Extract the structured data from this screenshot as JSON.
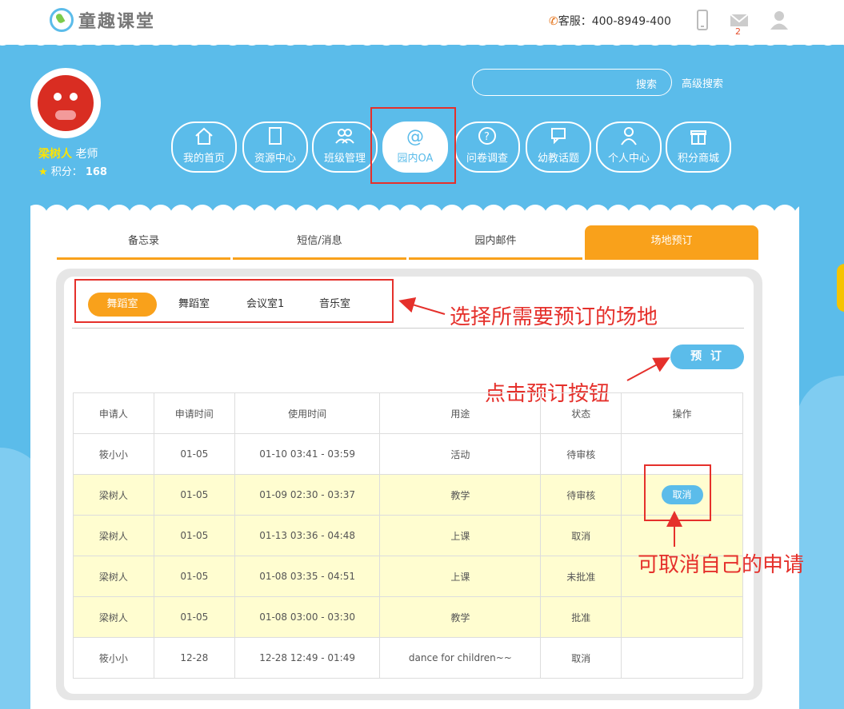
{
  "header": {
    "logo_text": "童趣课堂",
    "service_label": "客服：400-8949-400",
    "mail_badge": "2"
  },
  "profile": {
    "name": "梁树人",
    "role": "老师",
    "points_label": "积分：",
    "points_value": "168"
  },
  "search": {
    "button": "搜索",
    "advanced": "高级搜索"
  },
  "nav": [
    {
      "label": "我的首页",
      "icon": "home-icon"
    },
    {
      "label": "资源中心",
      "icon": "book-icon"
    },
    {
      "label": "班级管理",
      "icon": "group-icon"
    },
    {
      "label": "园内OA",
      "icon": "at-icon"
    },
    {
      "label": "问卷调查",
      "icon": "question-icon"
    },
    {
      "label": "幼教话题",
      "icon": "chat-icon"
    },
    {
      "label": "个人中心",
      "icon": "person-icon"
    },
    {
      "label": "积分商城",
      "icon": "gift-icon"
    }
  ],
  "tabs": [
    "备忘录",
    "短信/消息",
    "园内邮件",
    "场地预订"
  ],
  "venues": [
    "舞蹈室",
    "舞蹈室",
    "会议室1",
    "音乐室"
  ],
  "book_button": "预 订",
  "annotations": {
    "select_venue": "选择所需要预订的场地",
    "click_book": "点击预订按钮",
    "cancel_own": "可取消自己的申请"
  },
  "table": {
    "headers": [
      "申请人",
      "申请时间",
      "使用时间",
      "用途",
      "状态",
      "操作"
    ],
    "rows": [
      {
        "applicant": "筱小小",
        "apply_date": "01-05",
        "use_time": "01-10 03:41 - 03:59",
        "purpose": "活动",
        "status": "待审核",
        "action": ""
      },
      {
        "applicant": "梁树人",
        "apply_date": "01-05",
        "use_time": "01-09 02:30 - 03:37",
        "purpose": "教学",
        "status": "待审核",
        "action": "取消"
      },
      {
        "applicant": "梁树人",
        "apply_date": "01-05",
        "use_time": "01-13 03:36 - 04:48",
        "purpose": "上课",
        "status": "取消",
        "action": ""
      },
      {
        "applicant": "梁树人",
        "apply_date": "01-05",
        "use_time": "01-08 03:35 - 04:51",
        "purpose": "上课",
        "status": "未批准",
        "action": ""
      },
      {
        "applicant": "梁树人",
        "apply_date": "01-05",
        "use_time": "01-08 03:00 - 03:30",
        "purpose": "教学",
        "status": "批准",
        "action": ""
      },
      {
        "applicant": "筱小小",
        "apply_date": "12-28",
        "use_time": "12-28 12:49 - 01:49",
        "purpose": "dance for children~~",
        "status": "取消",
        "action": ""
      }
    ]
  },
  "colors": {
    "sky": "#5bbcea",
    "orange": "#f9a11b",
    "highlight_row": "#fffdd0",
    "annotation_red": "#e5302b"
  }
}
